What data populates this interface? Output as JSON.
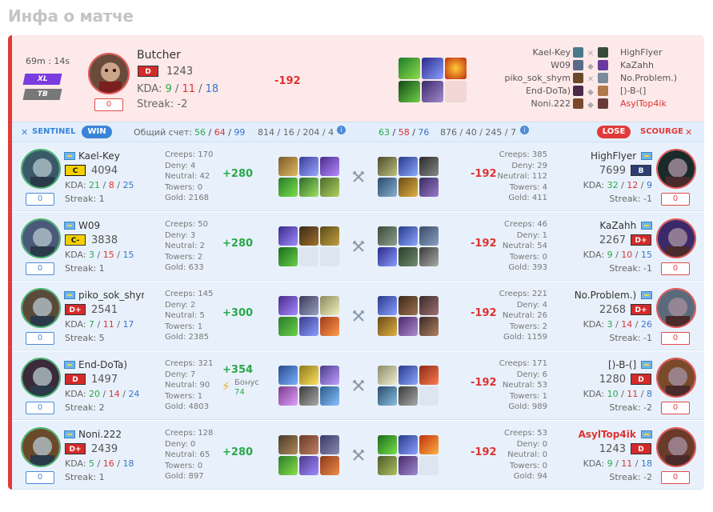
{
  "page_title": "Инфа о матче",
  "hero": {
    "duration": "69m : 14s",
    "tags": [
      "XL",
      "TB"
    ],
    "score_badge": "0",
    "player_name": "Butcher",
    "rank": "D",
    "mmr": "1243",
    "kda_label": "KDA:",
    "kda": {
      "k": "9",
      "d": "11",
      "a": "18"
    },
    "streak": "Streak: -2",
    "delta": "-192",
    "versus_left": [
      "Kael-Key",
      "W09",
      "piko_sok_shym",
      "End-DoTa)",
      "Noni.222"
    ],
    "versus_right": [
      "HighFlyer",
      "KaZahh",
      "No.Problem.)",
      "[)-B-(]",
      "AsylTop4ik"
    ]
  },
  "teams_bar": {
    "sentinel_label": "SENTINEL",
    "win_label": "WIN",
    "total_label": "Общий счет:",
    "sentinel_totals": {
      "k": "56",
      "d": "64",
      "a": "99"
    },
    "sentinel_cs": "814 / 16 / 204 / 4",
    "scourge_totals": {
      "k": "63",
      "d": "58",
      "a": "76"
    },
    "scourge_cs": "876 / 40 / 245 / 7",
    "lose_label": "LOSE",
    "scourge_label": "SCOURGE"
  },
  "rows": [
    {
      "left": {
        "name": "Kael-Key",
        "rank": "C",
        "mmr": "4094",
        "kda": {
          "k": "21",
          "d": "8",
          "a": "25"
        },
        "streak": "Streak: 1",
        "score": "0",
        "stats": [
          "Creeps: 170",
          "Deny: 4",
          "Neutral: 42",
          "Towers: 0",
          "Gold: 2168"
        ],
        "delta": "+280"
      },
      "right": {
        "name": "HighFlyer",
        "rank": "B",
        "mmr": "7699",
        "kda": {
          "k": "32",
          "d": "12",
          "a": "9"
        },
        "streak": "Streak: -1",
        "score": "0",
        "stats": [
          "Creeps: 385",
          "Deny: 29",
          "Neutral: 112",
          "Towers: 4",
          "Gold: 411"
        ],
        "delta": "-192"
      }
    },
    {
      "left": {
        "name": "W09",
        "rank": "C-",
        "mmr": "3838",
        "kda": {
          "k": "3",
          "d": "15",
          "a": "15"
        },
        "streak": "Streak: 1",
        "score": "0",
        "stats": [
          "Creeps: 50",
          "Deny: 3",
          "Neutral: 2",
          "Towers: 2",
          "Gold: 633"
        ],
        "delta": "+280"
      },
      "right": {
        "name": "KaZahh",
        "rank": "D+",
        "mmr": "2267",
        "kda": {
          "k": "9",
          "d": "10",
          "a": "15"
        },
        "streak": "Streak: -1",
        "score": "0",
        "stats": [
          "Creeps: 46",
          "Deny: 1",
          "Neutral: 54",
          "Towers: 0",
          "Gold: 393"
        ],
        "delta": "-192"
      }
    },
    {
      "left": {
        "name": "piko_sok_shym",
        "rank": "D+",
        "mmr": "2541",
        "kda": {
          "k": "7",
          "d": "11",
          "a": "17"
        },
        "streak": "Streak: 5",
        "score": "0",
        "stats": [
          "Creeps: 145",
          "Deny: 2",
          "Neutral: 5",
          "Towers: 1",
          "Gold: 2385"
        ],
        "delta": "+300"
      },
      "right": {
        "name": "No.Problem.)",
        "rank": "D+",
        "mmr": "2268",
        "kda": {
          "k": "3",
          "d": "14",
          "a": "26"
        },
        "streak": "Streak: -1",
        "score": "0",
        "stats": [
          "Creeps: 221",
          "Deny: 4",
          "Neutral: 26",
          "Towers: 2",
          "Gold: 1159"
        ],
        "delta": "-192"
      }
    },
    {
      "left": {
        "name": "End-DoTa)",
        "rank": "D",
        "mmr": "1497",
        "kda": {
          "k": "20",
          "d": "14",
          "a": "24"
        },
        "streak": "Streak: 2",
        "score": "0",
        "stats": [
          "Creeps: 321",
          "Deny: 7",
          "Neutral: 90",
          "Towers: 1",
          "Gold: 4803"
        ],
        "delta": "+354",
        "bonus_label": "Бонус",
        "bonus_value": "74"
      },
      "right": {
        "name": "[)-B-(]",
        "rank": "D",
        "mmr": "1280",
        "kda": {
          "k": "10",
          "d": "11",
          "a": "8"
        },
        "streak": "Streak: -2",
        "score": "0",
        "stats": [
          "Creeps: 171",
          "Deny: 6",
          "Neutral: 53",
          "Towers: 1",
          "Gold: 989"
        ],
        "delta": "-192"
      }
    },
    {
      "left": {
        "name": "Noni.222",
        "rank": "D+",
        "mmr": "2439",
        "kda": {
          "k": "5",
          "d": "16",
          "a": "18"
        },
        "streak": "Streak: 1",
        "score": "0",
        "stats": [
          "Creeps: 128",
          "Deny: 0",
          "Neutral: 65",
          "Towers: 0",
          "Gold: 897"
        ],
        "delta": "+280"
      },
      "right": {
        "name": "AsylTop4ik",
        "rank": "D",
        "mmr": "1243",
        "kda": {
          "k": "9",
          "d": "11",
          "a": "18"
        },
        "streak": "Streak: -2",
        "score": "0",
        "stats": [
          "Creeps: 53",
          "Deny: 0",
          "Neutral: 0",
          "Towers: 0",
          "Gold: 94"
        ],
        "delta": "-192"
      }
    }
  ],
  "kda_label": "KDA:",
  "colors": {
    "win": "#2aa84a",
    "lose": "#e23a3a",
    "sentinel": "#3a84d8",
    "accent_red": "#d33"
  }
}
